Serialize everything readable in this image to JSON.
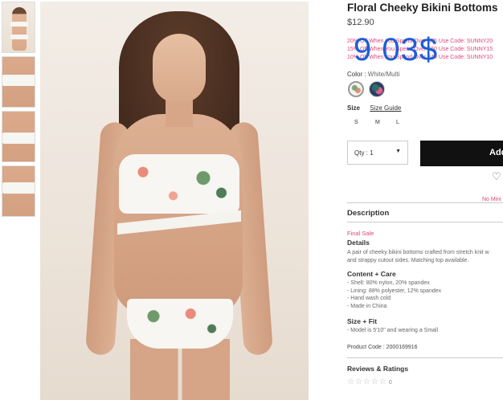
{
  "product": {
    "title": "Floral Cheeky Bikini Bottoms",
    "price": "$12.90",
    "promo_lines": [
      "20% Off When You Spend Over $75 Use Code: SUNNY20",
      "15% Off When You Spend Over $60 Use Code: SUNNY15",
      "10% Off When You Spend Over $40 Use Code: SUNNY10"
    ],
    "overlay_text": "9 03$",
    "color_label": "Color",
    "color_value": "White/Multi",
    "size_label": "Size",
    "size_guide": "Size Guide",
    "sizes": [
      "S",
      "M",
      "L"
    ],
    "qty_label": "Qty : 1",
    "add_button": "Add",
    "no_min_text": "No Mini"
  },
  "description": {
    "heading": "Description",
    "final_sale": "Final Sale",
    "details_heading": "Details",
    "details_lines": [
      "A pair of cheeky bikini bottoms crafted from stretch knit w",
      "and strappy cutout sides. Matching top available."
    ],
    "content_heading": "Content + Care",
    "content_lines": [
      "- Shell: 80% nylon, 20% spandex",
      "- Lining: 88% polyester, 12% spandex",
      "- Hand wash cold",
      "- Made in China"
    ],
    "fit_heading": "Size + Fit",
    "fit_lines": [
      "- Model is 5'10\" and wearing a Small"
    ],
    "product_code": "Product Code : 2000169916"
  },
  "reviews": {
    "heading": "Reviews & Ratings",
    "stars": "☆☆☆☆☆",
    "count": "0"
  },
  "colors": {
    "promo": "#e0457b",
    "overlay": "#1a5fd6",
    "button_bg": "#111111"
  }
}
